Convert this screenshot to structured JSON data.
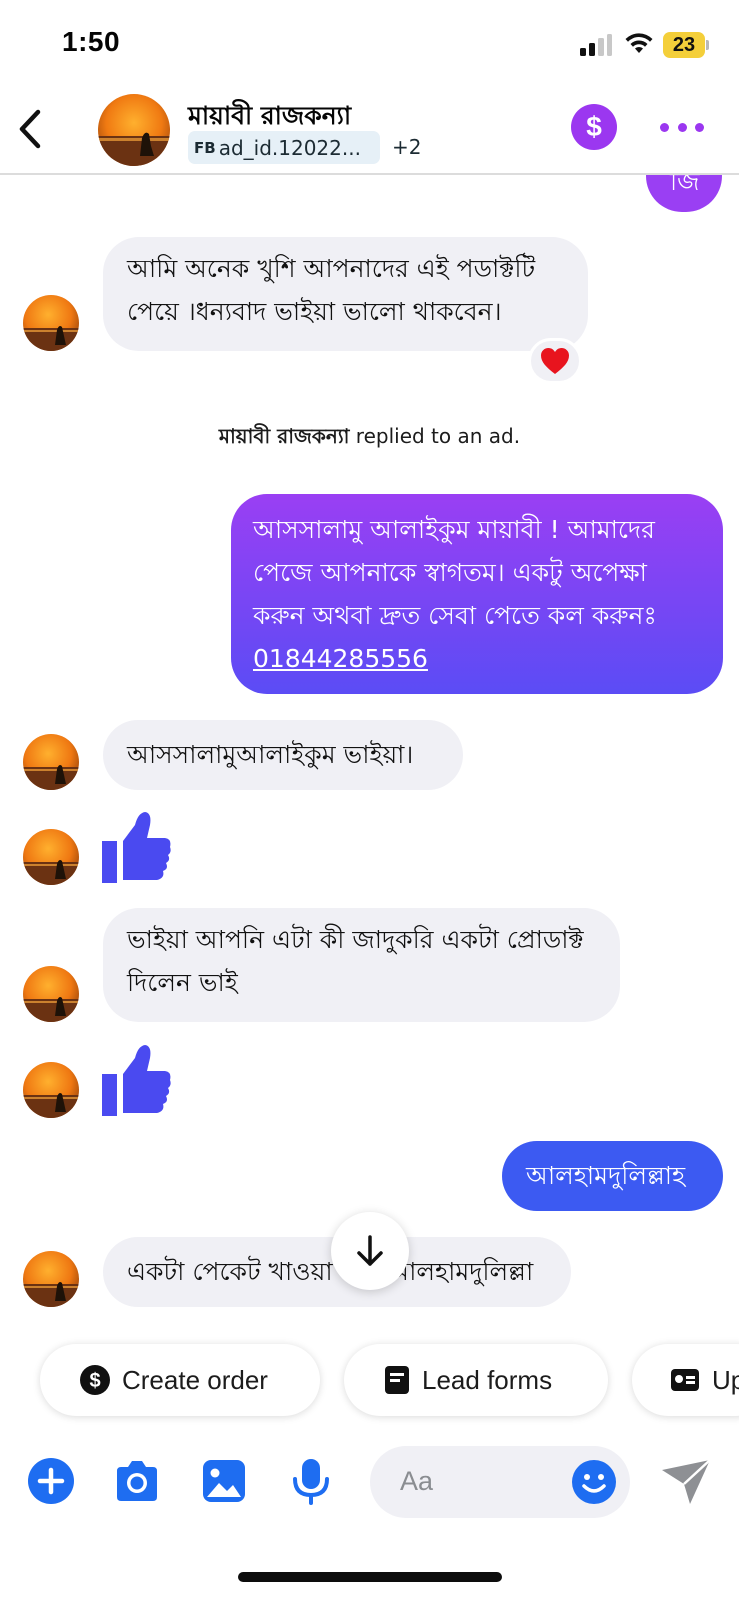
{
  "status_bar": {
    "time": "1:50",
    "battery": "23"
  },
  "header": {
    "contact_name": "মায়াবী রাজকন্যা",
    "ad_chip_prefix": "FB",
    "ad_chip_text": "ad_id.12022...",
    "extra_tags": "+2"
  },
  "messages": {
    "partial_out": "জি",
    "in_1": "আমি অনেক খুশি আপনাদের এই পডাক্টটি পেয়ে ।ধন্যবাদ ভাইয়া ভালো থাকবেন।",
    "in_1_line1": "আমি অনেক খুশি আপনাদের এই পডাক্টটি",
    "in_1_line2": "পেয়ে ।ধন্যবাদ ভাইয়া ভালো থাকবেন।",
    "in_1_reaction": "heart",
    "system_name": "মায়াবী রাজকন্যা",
    "system_text": " replied to an ad.",
    "out_greeting_line1": "আসসালামু আলাইকুম  মায়াবী !  আমাদের",
    "out_greeting_line2": "পেজে আপনাকে স্বাগতম। একটু অপেক্ষা",
    "out_greeting_line3": "করুন অথবা দ্রুত সেবা পেতে কল করুনঃ",
    "out_greeting_phone": "01844285556",
    "in_2": "আসসালামুআলাইকুম ভাইয়া।",
    "in_3_line1": "ভাইয়া আপনি এটা কী জাদুকরি একটা প্রোডাক্ট",
    "in_3_line2": "দিলেন ভাই",
    "out_2": "আলহামদুলিল্লাহ",
    "in_4": "একটা পেকেট খাওয়া শেষ আলহামদুলিল্লা"
  },
  "actions": {
    "create_order": "Create order",
    "lead_forms": "Lead forms",
    "third_partial": "Up"
  },
  "composer": {
    "placeholder": "Aa"
  },
  "colors": {
    "accent_purple": "#9b37f0",
    "out_bubble_gradient_top": "#9a3ff3",
    "out_bubble_gradient_bottom": "#5b4cf5",
    "out_bubble_blue": "#3c5af2",
    "thumb_blue": "#4a4af0",
    "composer_blue": "#1e6df1"
  },
  "icons": [
    "back-icon",
    "dollar-icon",
    "more-icon",
    "heart-icon",
    "thumbs-up-icon",
    "arrow-down-icon",
    "plus-icon",
    "camera-icon",
    "gallery-icon",
    "mic-icon",
    "emoji-icon",
    "send-icon"
  ]
}
